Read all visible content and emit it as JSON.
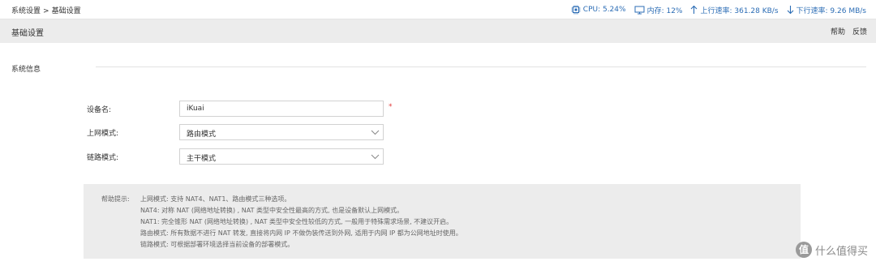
{
  "breadcrumb": {
    "parent": "系统设置",
    "separator": ">",
    "current": "基础设置"
  },
  "stats": {
    "cpu": "CPU: 5.24%",
    "memory": "内存: 12%",
    "upload": "上行速率: 361.28 KB/s",
    "download": "下行速率: 9.26 MB/s",
    "accent_color": "#2c6db5"
  },
  "header": {
    "title": "基础设置",
    "help": "帮助",
    "feedback": "反馈"
  },
  "section": {
    "title": "系统信息"
  },
  "form": {
    "device_name_label": "设备名:",
    "device_name_value": "iKuai",
    "required_mark": "*",
    "wan_mode_label": "上网模式:",
    "wan_mode_value": "路由模式",
    "link_mode_label": "链路模式:",
    "link_mode_value": "主干模式"
  },
  "help": {
    "title": "帮助提示:",
    "line1": "上网模式: 支持 NAT4、NAT1、路由模式三种选项。",
    "line2": "NAT4: 对称 NAT (网络地址转换) ,  NAT 类型中安全性最高的方式, 也是设备默认上网模式。",
    "line3": "NAT1: 完全锥形 NAT (网络地址转换) ,  NAT 类型中安全性较低的方式, 一般用于特殊需求场景, 不建议开启。",
    "line4": "路由模式: 所有数据不进行 NAT 转发, 直接将内网 IP 不做伪装传送到外网, 适用于内网 IP 都为公网地址时使用。",
    "line5": "链路模式: 可根据部署环境选择当前设备的部署模式。"
  },
  "watermark": {
    "badge": "值",
    "text": "什么值得买"
  }
}
